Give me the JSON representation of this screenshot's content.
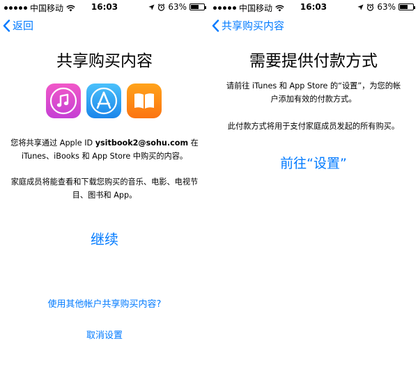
{
  "status_bar": {
    "carrier": "中国移动",
    "time": "16:03",
    "battery": "63%",
    "battery_level": 0.63
  },
  "left": {
    "back_label": "返回",
    "title": "共享购买内容",
    "desc1_pre": "您将共享通过 Apple ID ",
    "desc1_id": "ysitbook2@sohu.com",
    "desc1_post": " 在 iTunes、iBooks 和 App Store 中购买的内容。",
    "desc2": "家庭成员将能查看和下载您购买的音乐、电影、电视节目、图书和 App。",
    "continue_label": "继续",
    "other_account_label": "使用其他帐户共享购买内容?",
    "cancel_label": "取消设置"
  },
  "right": {
    "back_label": "共享购买内容",
    "title": "需要提供付款方式",
    "desc1": "请前往 iTunes 和 App Store 的“设置”，为您的帐户添加有效的付款方式。",
    "desc2": "此付款方式将用于支付家庭成员发起的所有购买。",
    "settings_label": "前往“设置”"
  },
  "icons": [
    "itunes-music-icon",
    "app-store-icon",
    "ibooks-icon"
  ],
  "colors": {
    "accent": "#007aff"
  }
}
